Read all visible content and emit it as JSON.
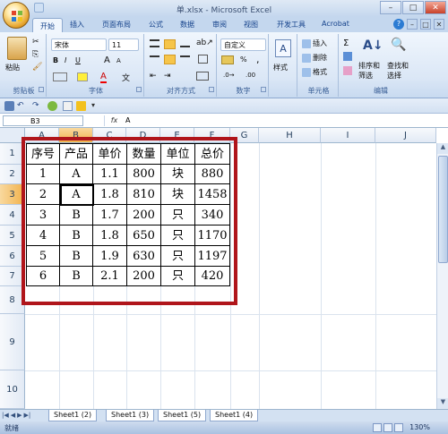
{
  "window": {
    "title": "单.xlsx - Microsoft Excel",
    "min": "–",
    "max": "□",
    "close": "✕"
  },
  "tabs": [
    "开始",
    "插入",
    "页面布局",
    "公式",
    "数据",
    "审阅",
    "视图",
    "开发工具",
    "Acrobat"
  ],
  "ribbon": {
    "clipboard": {
      "paste": "粘贴",
      "label": "剪贴板"
    },
    "font": {
      "name": "宋体",
      "size": "11",
      "bold": "B",
      "italic": "I",
      "underline": "U",
      "grow": "A",
      "shrink": "A",
      "label": "字体"
    },
    "alignment": {
      "label": "对齐方式"
    },
    "number": {
      "format": "自定义",
      "percent": "%",
      "comma": ",",
      "label": "数字"
    },
    "styles": {
      "styles": "样式"
    },
    "cells": {
      "insert": "插入",
      "delete": "删除",
      "format": "格式",
      "label": "单元格"
    },
    "editing": {
      "sort": "排序和\n筛选",
      "find": "查找和\n选择",
      "label": "编辑"
    }
  },
  "formula_bar": {
    "name_box": "B3",
    "fx": "fx",
    "content": "A"
  },
  "columns": [
    "A",
    "B",
    "C",
    "D",
    "E",
    "F",
    "G",
    "H",
    "I",
    "J"
  ],
  "rows": [
    "1",
    "2",
    "3",
    "4",
    "5",
    "6",
    "7",
    "8",
    "9",
    "10"
  ],
  "table": {
    "headers": [
      "序号",
      "产品",
      "单价",
      "数量",
      "单位",
      "总价"
    ],
    "rows": [
      [
        "1",
        "A",
        "1.1",
        "800",
        "块",
        "880"
      ],
      [
        "2",
        "A",
        "1.8",
        "810",
        "块",
        "1458"
      ],
      [
        "3",
        "B",
        "1.7",
        "200",
        "只",
        "340"
      ],
      [
        "4",
        "B",
        "1.8",
        "650",
        "只",
        "1170"
      ],
      [
        "5",
        "B",
        "1.9",
        "630",
        "只",
        "1197"
      ],
      [
        "6",
        "B",
        "2.1",
        "200",
        "只",
        "420"
      ]
    ]
  },
  "sheets": [
    "Sheet1 (2)",
    "Sheet1 (3)",
    "Sheet1 (5)",
    "Sheet1 (4)"
  ],
  "status": {
    "ready": "就绪",
    "zoom": "130%"
  },
  "colors": {
    "highlight": "#b0151b",
    "header_selected": "#f1b24c"
  }
}
